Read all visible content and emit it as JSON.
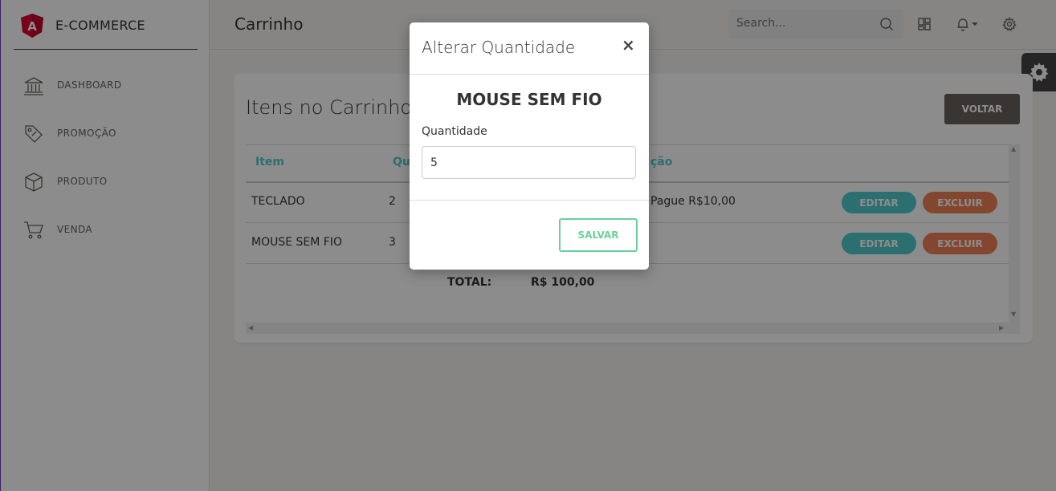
{
  "brand": {
    "name": "E-COMMERCE",
    "logo_text": "A"
  },
  "sidebar": {
    "items": [
      {
        "label": "DASHBOARD",
        "icon": "bank-icon"
      },
      {
        "label": "PROMOÇÃO",
        "icon": "tag-icon"
      },
      {
        "label": "PRODUTO",
        "icon": "box-icon"
      },
      {
        "label": "VENDA",
        "icon": "cart-icon"
      }
    ]
  },
  "header": {
    "title": "Carrinho",
    "search_placeholder": "Search..."
  },
  "card": {
    "title": "Itens no Carrinho",
    "back_label": "VOLTAR",
    "columns": [
      "Item",
      "Qu",
      "ção"
    ],
    "rows": [
      {
        "item": "TECLADO",
        "qty": "2",
        "promo": "Pague R$10,00"
      },
      {
        "item": "MOUSE SEM FIO",
        "qty": "3",
        "promo": ""
      }
    ],
    "edit_label": "EDITAR",
    "delete_label": "EXCLUIR",
    "total_label": "TOTAL:",
    "total_value": "R$ 100,00"
  },
  "modal": {
    "title": "Alterar Quantidade",
    "close_label": "×",
    "product": "MOUSE SEM FIO",
    "qty_label": "Quantidade",
    "qty_value": "5",
    "save_label": "SALVAR"
  },
  "colors": {
    "accent_teal": "#51cbce",
    "danger_orange": "#ef8157",
    "success_green": "#6bd098",
    "dark_button": "#66615b",
    "logo_red": "#dd0031"
  }
}
